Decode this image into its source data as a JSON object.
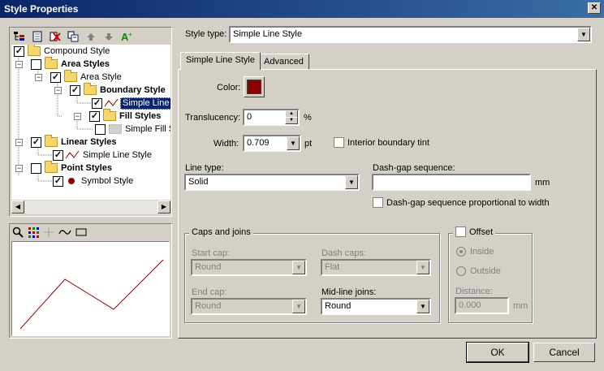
{
  "window": {
    "title": "Style Properties",
    "close_glyph": "✕"
  },
  "toolbar_icons": [
    "new-child-icon",
    "new-icon",
    "delete-icon",
    "copy-icon",
    "move-up-icon",
    "move-down-icon",
    "font-icon"
  ],
  "tree": {
    "items": [
      {
        "label": "Compound Style",
        "checked": true,
        "bold": false
      },
      {
        "label": "Area Styles",
        "checked": false,
        "bold": true
      },
      {
        "label": "Area Style",
        "checked": true,
        "bold": false
      },
      {
        "label": "Boundary Style",
        "checked": true,
        "bold": true
      },
      {
        "label": "Simple Line S",
        "checked": true,
        "bold": false
      },
      {
        "label": "Fill Styles",
        "checked": true,
        "bold": true
      },
      {
        "label": "Simple Fill Sty",
        "checked": false,
        "bold": false
      },
      {
        "label": "Linear Styles",
        "checked": true,
        "bold": true
      },
      {
        "label": "Simple Line Style",
        "checked": true,
        "bold": false
      },
      {
        "label": "Point Styles",
        "checked": false,
        "bold": true
      },
      {
        "label": "Symbol Style",
        "checked": true,
        "bold": false
      }
    ]
  },
  "preview_toolbar_icons": [
    "zoom-icon",
    "points-icon",
    "crosshair-icon",
    "line-icon",
    "rectangle-icon"
  ],
  "style_type": {
    "label": "Style type:",
    "value": "Simple Line Style"
  },
  "tabs": [
    {
      "label": "Simple Line Style"
    },
    {
      "label": "Advanced"
    }
  ],
  "form": {
    "color_label": "Color:",
    "color_value": "#8b0000",
    "translucency_label": "Translucency:",
    "translucency_value": "0",
    "translucency_unit": "%",
    "width_label": "Width:",
    "width_value": "0.709",
    "width_unit": "pt",
    "interior_boundary_tint": "Interior boundary tint",
    "line_type_label": "Line type:",
    "line_type_value": "Solid",
    "dash_gap_label": "Dash-gap sequence:",
    "dash_gap_value": "",
    "dash_gap_unit": "mm",
    "dash_gap_proportional": "Dash-gap sequence proportional to width"
  },
  "caps_joins": {
    "title": "Caps and joins",
    "start_cap_label": "Start cap:",
    "start_cap_value": "Round",
    "dash_caps_label": "Dash caps:",
    "dash_caps_value": "Flat",
    "end_cap_label": "End cap:",
    "end_cap_value": "Round",
    "midline_joins_label": "Mid-line joins:",
    "midline_joins_value": "Round"
  },
  "offset": {
    "title": "Offset",
    "inside": "Inside",
    "outside": "Outside",
    "distance_label": "Distance:",
    "distance_value": "0.000",
    "distance_unit": "mm"
  },
  "buttons": {
    "ok": "OK",
    "cancel": "Cancel"
  }
}
